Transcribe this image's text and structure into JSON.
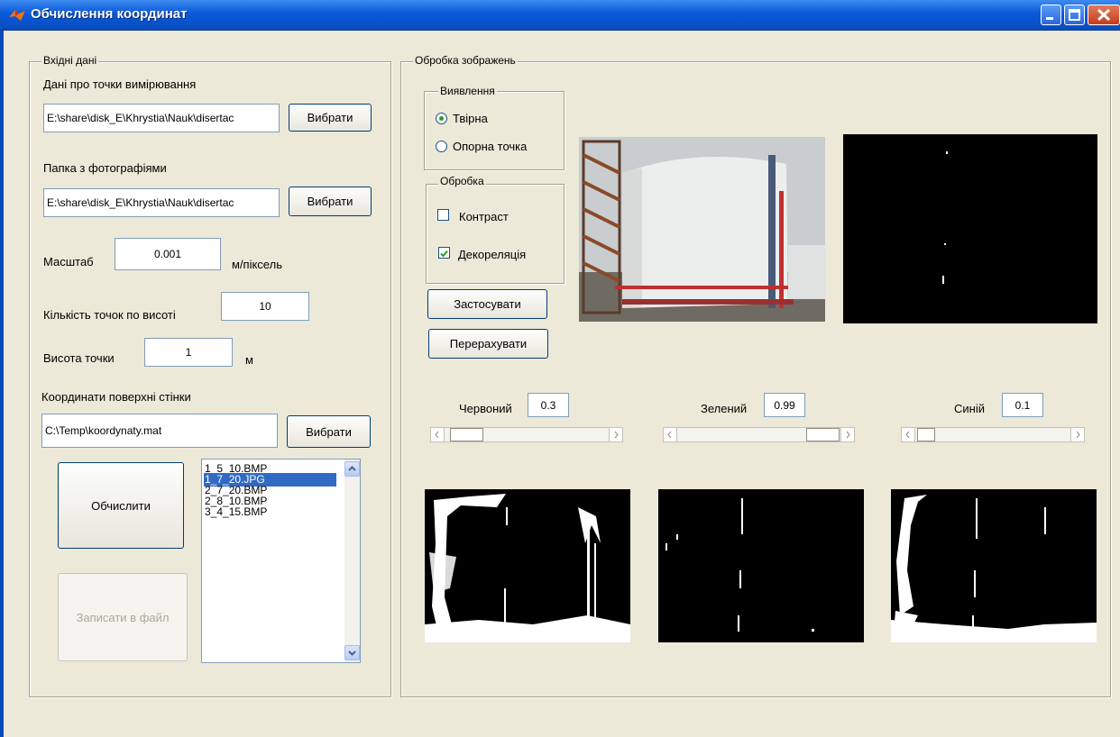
{
  "window": {
    "title": "Обчислення координат"
  },
  "input_panel": {
    "title": "Вхідні дані",
    "points_label": "Дані про точки вимірювання",
    "points_path": "E:\\share\\disk_E\\Khrystia\\Nauk\\disertac",
    "photos_label": "Папка з фотографіями",
    "photos_path": "E:\\share\\disk_E\\Khrystia\\Nauk\\disertac",
    "browse_label": "Вибрати",
    "scale_label": "Масштаб",
    "scale_value": "0.001",
    "scale_unit": "м/піксель",
    "count_label": "Кількість точок по висоті",
    "count_value": "10",
    "height_label": "Висота точки",
    "height_value": "1",
    "height_unit": "м",
    "coords_label": "Координати поверхні стінки",
    "coords_path": "C:\\Temp\\koordynaty.mat",
    "compute_label": "Обчислити",
    "save_label": "Записати в файл",
    "files": [
      "1_5_10.BMP",
      "1_7_20.JPG",
      "2_7_20.BMP",
      "2_8_10.BMP",
      "3_4_15.BMP"
    ],
    "selected_file": "1_7_20.JPG"
  },
  "processing_panel": {
    "title": "Обробка зображень",
    "detect_title": "Виявлення",
    "detect_options": [
      "Твірна",
      "Опорна точка"
    ],
    "detect_selected": "Твірна",
    "process_title": "Обробка",
    "contrast_label": "Контраст",
    "contrast_checked": false,
    "decorrelation_label": "Декореляція",
    "decorrelation_checked": true,
    "apply_label": "Застосувати",
    "recalc_label": "Перерахувати",
    "red_label": "Червоний",
    "red_value": "0.3",
    "green_label": "Зелений",
    "green_value": "0.99",
    "blue_label": "Синій",
    "blue_value": "0.1",
    "red_level": 0.3,
    "green_level": 0.99,
    "blue_level": 0.1
  },
  "colors": {
    "accent": "#316ac5",
    "titlebar": "#0a58d8",
    "window_bg": "#ece9d8",
    "radio_dot": "#21a121"
  }
}
